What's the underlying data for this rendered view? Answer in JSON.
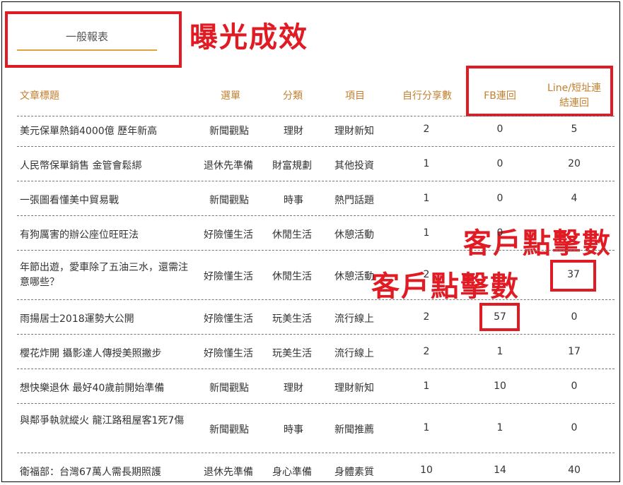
{
  "tab": {
    "label": "一般報表"
  },
  "annotations": {
    "exposure": "曝光成效",
    "clicks_right": "客戶點擊數",
    "clicks_middle": "客戶點擊數"
  },
  "columns": {
    "title": "文章標題",
    "menu": "選單",
    "category": "分類",
    "item": "項目",
    "self_share": "自行分享數",
    "fb": "FB連回",
    "line_line1": "Line/短址連",
    "line_line2": "結連回"
  },
  "rows": [
    {
      "title": "美元保單熱銷4000億 歷年新高",
      "menu": "新聞觀點",
      "category": "理財",
      "item": "理財新知",
      "self_share": "2",
      "fb": "0",
      "line": "5"
    },
    {
      "title": "人民幣保單銷售 金管會鬆綁",
      "menu": "退休先準備",
      "category": "財富規劃",
      "item": "其他投資",
      "self_share": "1",
      "fb": "0",
      "line": "20"
    },
    {
      "title": "一張圖看懂美中貿易戰",
      "menu": "新聞觀點",
      "category": "時事",
      "item": "熱門話題",
      "self_share": "1",
      "fb": "0",
      "line": "4"
    },
    {
      "title": "有狗厲害的辦公座位旺旺法",
      "menu": "好險懂生活",
      "category": "休閒生活",
      "item": "休憩活動",
      "self_share": "1",
      "fb": "0",
      "line": ""
    },
    {
      "title": "年節出遊，愛車除了五油三水，還需注意哪些？",
      "menu": "好險懂生活",
      "category": "休閒生活",
      "item": "休憩活動",
      "self_share": "2",
      "fb": "",
      "line": "37"
    },
    {
      "title": "雨揚居士2018運勢大公開",
      "menu": "好險懂生活",
      "category": "玩美生活",
      "item": "流行線上",
      "self_share": "2",
      "fb": "57",
      "line": "0"
    },
    {
      "title": "櫻花炸開 攝影達人傳授美照撇步",
      "menu": "好險懂生活",
      "category": "玩美生活",
      "item": "流行線上",
      "self_share": "2",
      "fb": "1",
      "line": "17"
    },
    {
      "title": "想快樂退休 最好40歲前開始準備",
      "menu": "新聞觀點",
      "category": "理財",
      "item": "理財新知",
      "self_share": "1",
      "fb": "10",
      "line": "0"
    },
    {
      "title": "與鄰爭執就縱火 龍江路租屋客1死7傷",
      "menu": "新聞觀點",
      "category": "時事",
      "item": "新聞推薦",
      "self_share": "1",
      "fb": "1",
      "line": "0"
    },
    {
      "title": "衛福部：台灣67萬人需長期照護",
      "menu": "退休先準備",
      "category": "身心準備",
      "item": "身體素質",
      "self_share": "10",
      "fb": "14",
      "line": "40"
    }
  ]
}
